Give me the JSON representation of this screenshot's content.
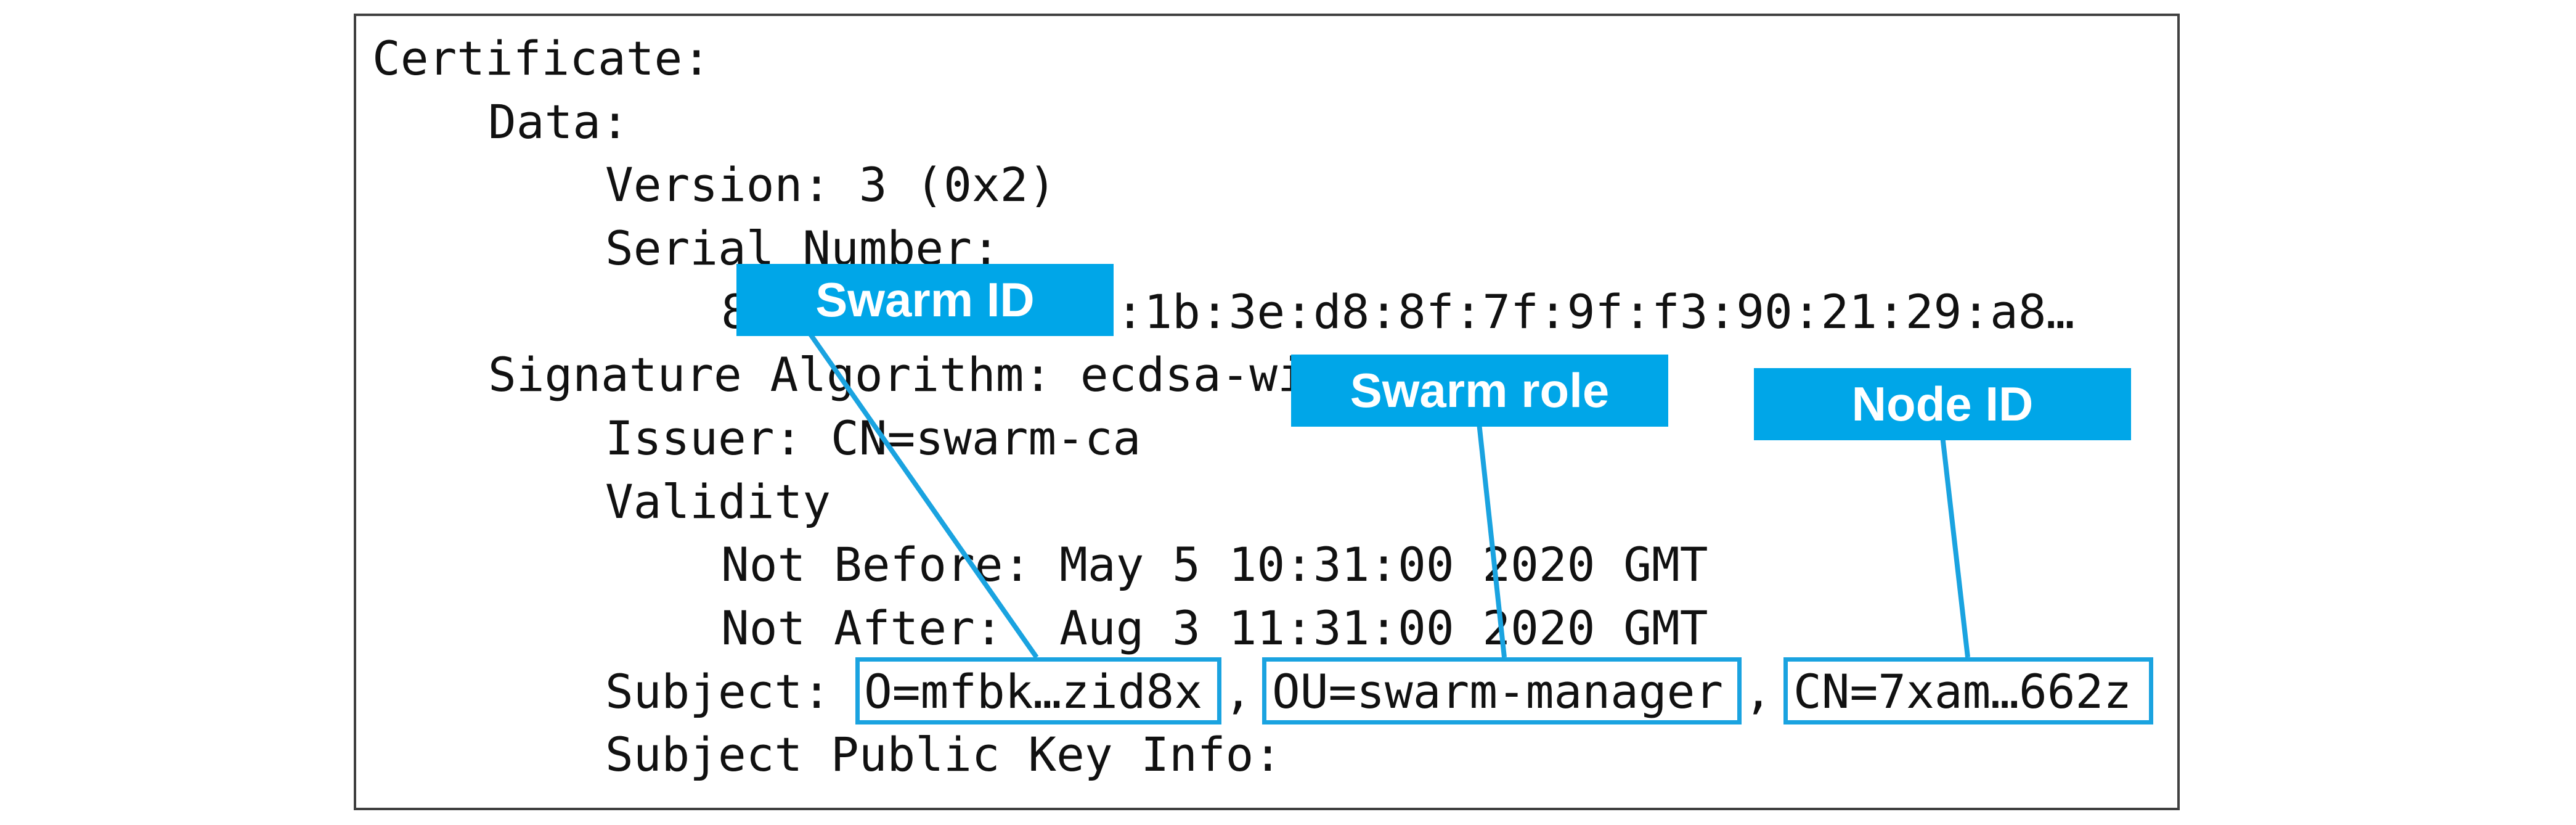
{
  "certificate": {
    "lines": [
      "Certificate:",
      "Data:",
      "Version: 3 (0x2)",
      "Serial Number:",
      "8c:39:83:05:44:1b:3e:d8:8f:7f:9f:f3:90:21:29:a8…",
      "Signature Algorithm: ecdsa-with-SHA256",
      "Issuer: CN=swarm-ca",
      "Validity",
      "Not Before: May 5 10:31:00 2020 GMT",
      "Not After:  Aug 3 11:31:00 2020 GMT",
      "Subject Public Key Info:"
    ],
    "subject": {
      "label": "Subject:",
      "o": "O=mfbk…zid8x",
      "sep1": ",",
      "ou": "OU=swarm-manager",
      "sep2": ",",
      "cn": "CN=7xam…662z"
    }
  },
  "callouts": {
    "swarm_id": "Swarm ID",
    "swarm_role": "Swarm role",
    "node_id": "Node ID"
  },
  "colors": {
    "accent": "#00a6e8",
    "highlight_border": "#1aa3e0",
    "frame": "#404040",
    "text": "#111111"
  }
}
